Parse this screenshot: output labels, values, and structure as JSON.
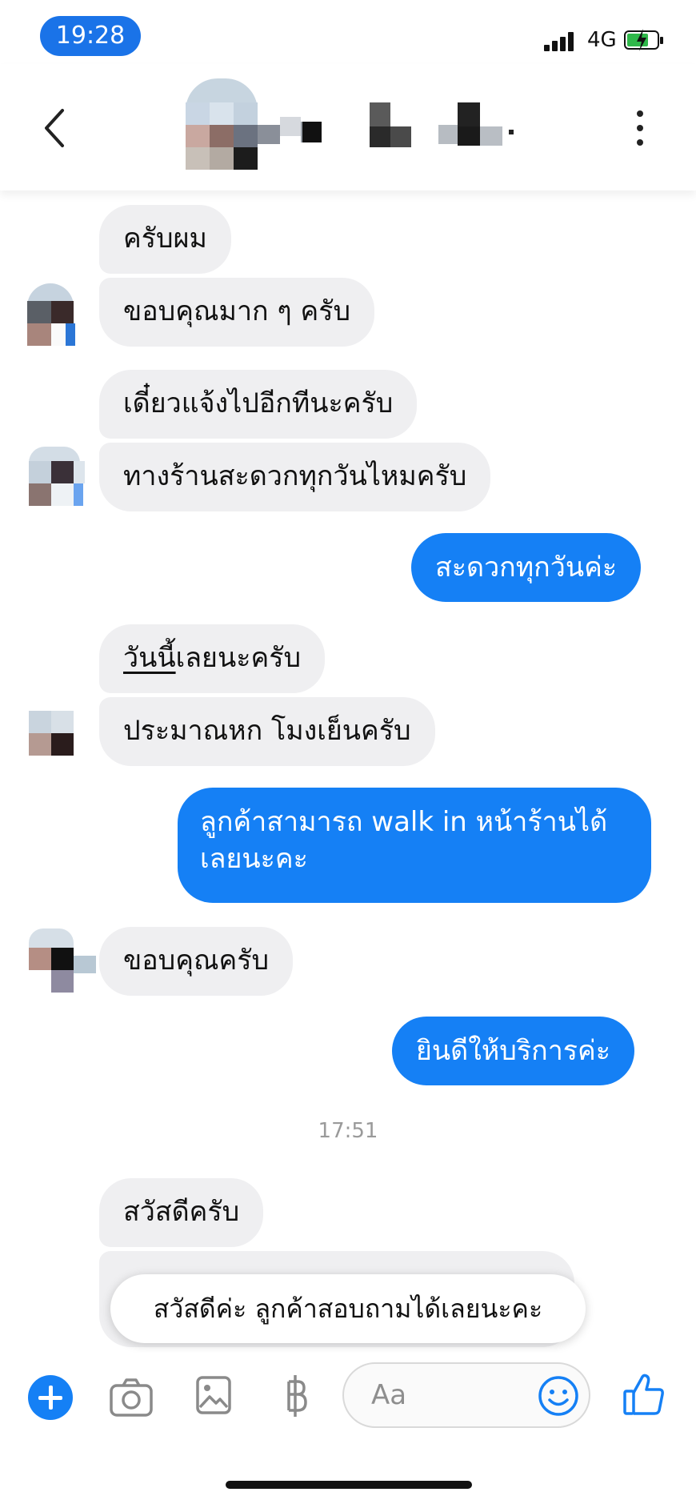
{
  "status_bar": {
    "time": "19:28",
    "network": "4G"
  },
  "colors": {
    "accent": "#1580f5",
    "incoming_bubble": "#efeff1",
    "time_pill": "#1a73e8"
  },
  "header": {
    "back_icon": "chevron-left-icon",
    "menu_icon": "more-vertical-icon"
  },
  "messages": {
    "m1": "ครับผม",
    "m2": "ขอบคุณมาก ๆ ครับ",
    "m3": "เดี๋ยวแจ้งไปอีกทีนะครับ",
    "m4": "ทางร้านสะดวกทุกวันไหมครับ",
    "m5": "สะดวกทุกวันค่ะ",
    "m6a": "วันนี้",
    "m6b": "เลยนะครับ",
    "m7": "ประมาณหก โมงเย็นครับ",
    "m8": "ลูกค้าสามารถ walk in หน้าร้านได้เลยนะคะ",
    "m9": "ขอบคุณครับ",
    "m10": "ยินดีให้บริการค่ะ",
    "timestamp": "17:51",
    "m11": "สวัสดีครับ"
  },
  "quick_reply": "สวัสดีค่ะ ลูกค้าสอบถามได้เลยนะคะ",
  "composer": {
    "placeholder": "Aa",
    "icons": [
      "plus-icon",
      "camera-icon",
      "image-icon",
      "baht-icon",
      "emoji-icon",
      "thumbs-up-icon"
    ]
  }
}
